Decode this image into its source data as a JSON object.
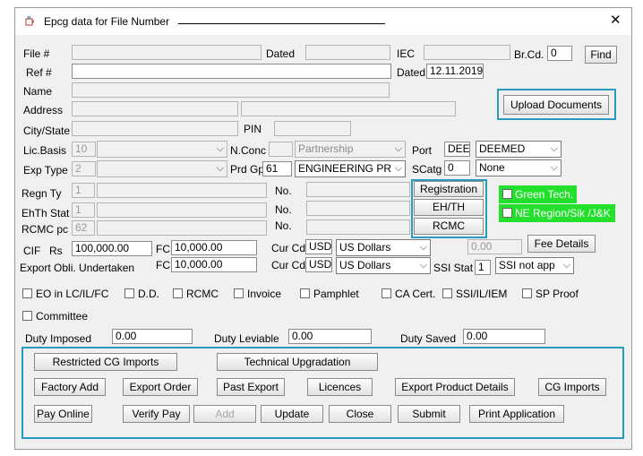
{
  "window": {
    "title": "Epcg data for File Number",
    "close_glyph": "✕"
  },
  "fields": {
    "file_no": {
      "label": "File #",
      "value": ""
    },
    "dated1": {
      "label": "Dated",
      "value": ""
    },
    "iec": {
      "label": "IEC",
      "value": ""
    },
    "brcd": {
      "label": "Br.Cd.",
      "value": "0"
    },
    "find_label": "Find",
    "ref_no": {
      "label": "Ref #",
      "value": ""
    },
    "dated2": {
      "label": "Dated",
      "value": "12.11.2019"
    },
    "name": {
      "label": "Name",
      "value": ""
    },
    "address": {
      "label": "Address"
    },
    "city_state": {
      "label": "City/State"
    },
    "pin": {
      "label": "PIN"
    },
    "upload_label": "Upload Documents",
    "lic_basis": {
      "label": "Lic.Basis",
      "value": "10"
    },
    "nconc": {
      "label": "N.Conc",
      "value": "Partnership"
    },
    "port": {
      "label": "Port",
      "code": "DEE",
      "value": "DEEMED"
    },
    "exp_type": {
      "label": "Exp Type",
      "value": "2"
    },
    "prd_gp": {
      "label": "Prd Gp",
      "code": "61",
      "value": "ENGINEERING PR"
    },
    "scatg": {
      "label": "SCatg",
      "code": "0",
      "value": "None"
    },
    "regn_ty": {
      "label": "Regn Ty",
      "value": "1"
    },
    "ehth_stat": {
      "label": "EhTh Stat",
      "value": "1"
    },
    "rcmc_pc": {
      "label": "RCMC pc",
      "value": "62"
    },
    "no_label": "No.",
    "registration_label": "Registration",
    "ehth_label": "EH/TH",
    "rcmc_btn_label": "RCMC",
    "green_tech": "Green Tech.",
    "ne_region": "NE Region/Sik /J&K",
    "cif": {
      "label": "CIF",
      "rs_label": "Rs",
      "value": "100,000.00",
      "fc_label": "FC",
      "fc_value": "10,000.00",
      "cur_label": "Cur Cd",
      "cur_code": "USD",
      "currency": "US Dollars",
      "disabled_value": "0.00"
    },
    "fee_details_label": "Fee Details",
    "export_obli": {
      "label": "Export Obli. Undertaken",
      "fc_label": "FC",
      "fc_value": "10,000.00",
      "cur_label": "Cur Cd",
      "cur_code": "USD",
      "currency": "US Dollars"
    },
    "ssi_stat": {
      "label": "SSI Stat",
      "code": "1",
      "value": "SSI not app"
    }
  },
  "checkboxes": [
    "EO in LC/IL/FC",
    "D.D.",
    "RCMC",
    "Invoice",
    "Pamphlet",
    "CA Cert.",
    "SSI/IL/IEM",
    "SP Proof"
  ],
  "committee_label": "Committee",
  "duty": {
    "imposed": {
      "label": "Duty Imposed",
      "value": "0.00"
    },
    "leviable": {
      "label": "Duty Leviable",
      "value": "0.00"
    },
    "saved": {
      "label": "Duty Saved",
      "value": "0.00"
    }
  },
  "buttons": {
    "restricted": "Restricted CG Imports",
    "technical": "Technical Upgradation",
    "factory_add": "Factory Add",
    "export_order": "Export Order",
    "past_export": "Past Export",
    "licences": "Licences",
    "export_product": "Export Product  Details",
    "cg_imports": "CG Imports",
    "pay_online": "Pay Online",
    "verify_pay": "Verify Pay",
    "add": "Add",
    "update": "Update",
    "close": "Close",
    "submit": "Submit",
    "print_application": "Print Application"
  },
  "colors": {
    "highlight": "#2a9bbf",
    "green": "#22e02c"
  },
  "icons": {
    "app": "java-cup-icon",
    "close": "close-icon",
    "dropdown": "chevron-down-icon"
  }
}
